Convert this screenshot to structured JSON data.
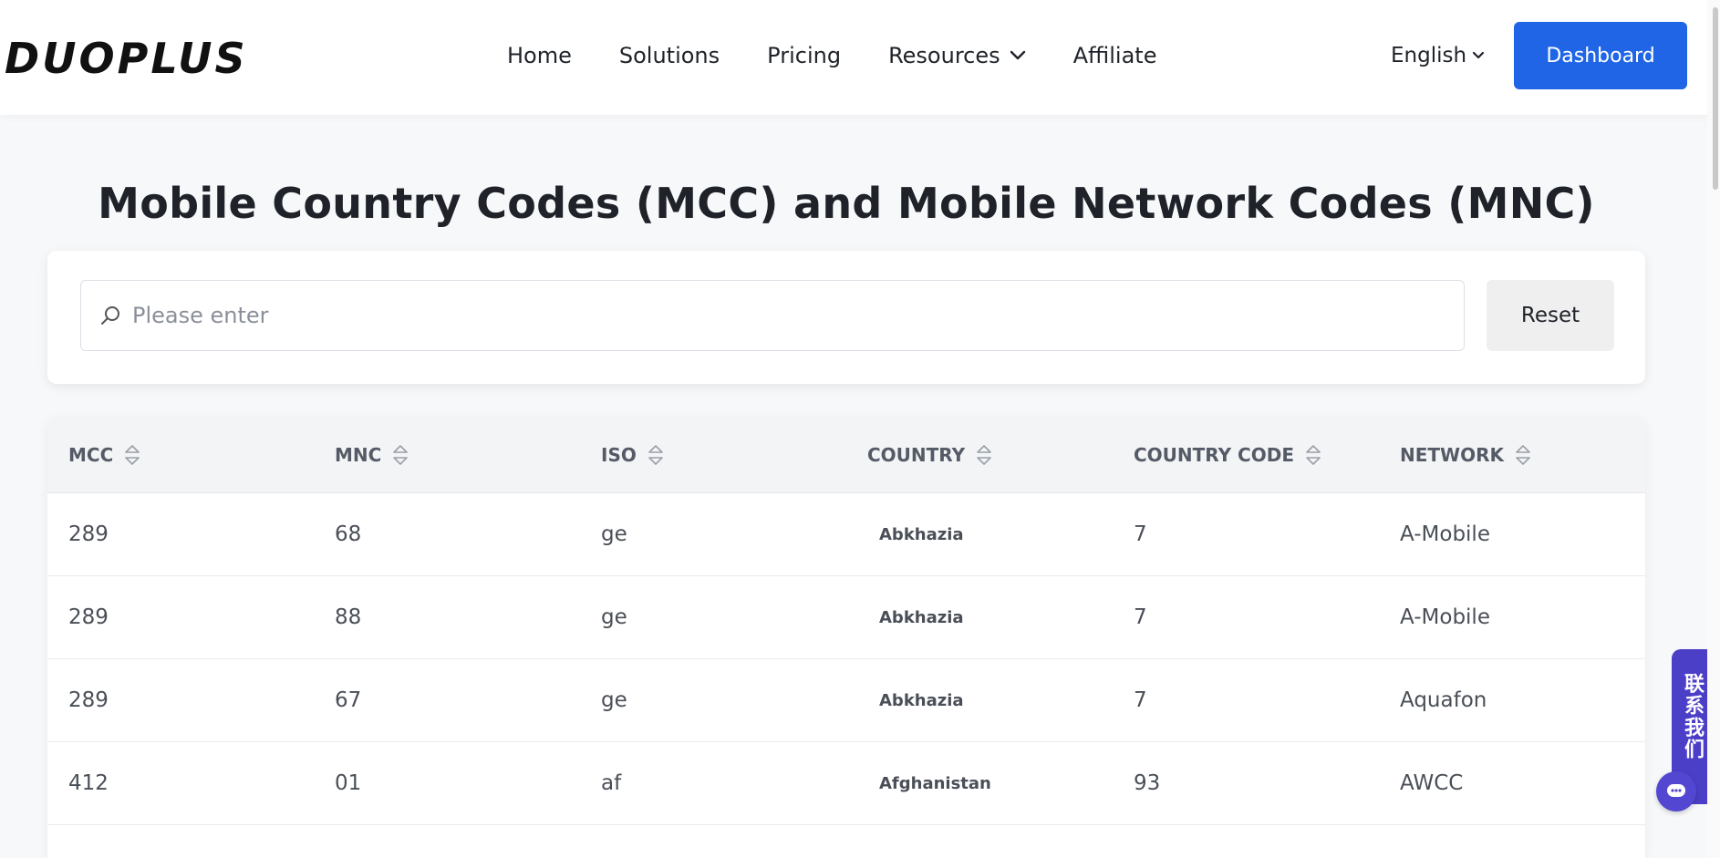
{
  "header": {
    "logo_text": "DUOPLUS",
    "nav": [
      {
        "label": "Home"
      },
      {
        "label": "Solutions"
      },
      {
        "label": "Pricing"
      },
      {
        "label": "Resources",
        "has_dropdown": true
      },
      {
        "label": "Affiliate"
      }
    ],
    "language": "English",
    "dashboard_label": "Dashboard"
  },
  "page": {
    "title": "Mobile Country Codes (MCC) and Mobile Network Codes (MNC)"
  },
  "search": {
    "placeholder": "Please enter",
    "value": "",
    "reset_label": "Reset"
  },
  "table": {
    "columns": [
      "MCC",
      "MNC",
      "ISO",
      "COUNTRY",
      "COUNTRY CODE",
      "NETWORK"
    ],
    "rows": [
      [
        "289",
        "68",
        "ge",
        "Abkhazia",
        "7",
        "A-Mobile"
      ],
      [
        "289",
        "88",
        "ge",
        "Abkhazia",
        "7",
        "A-Mobile"
      ],
      [
        "289",
        "67",
        "ge",
        "Abkhazia",
        "7",
        "Aquafon"
      ],
      [
        "412",
        "01",
        "af",
        "Afghanistan",
        "93",
        "AWCC"
      ]
    ]
  },
  "contact": {
    "label": "联系我们"
  },
  "colors": {
    "brand_blue": "#1f65e6",
    "contact_purple": "#4b3fc8"
  },
  "icons": [
    "search-icon",
    "chevron-down-icon",
    "sort-icon",
    "chat-icon"
  ]
}
